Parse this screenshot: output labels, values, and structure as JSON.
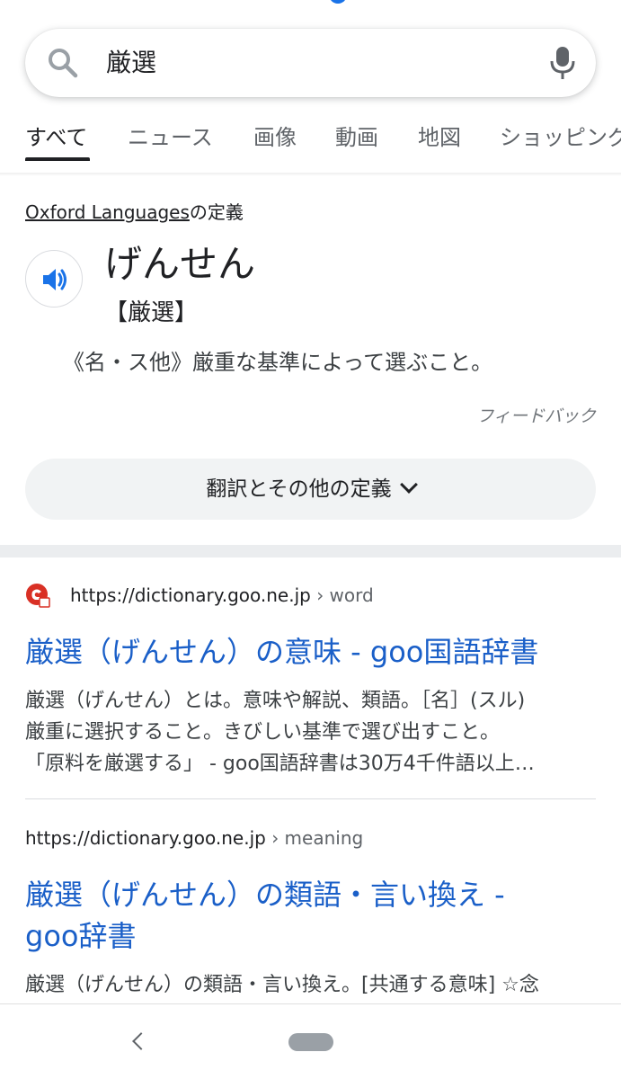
{
  "search": {
    "query": "厳選"
  },
  "tabs": [
    {
      "label": "すべて"
    },
    {
      "label": "ニュース"
    },
    {
      "label": "画像"
    },
    {
      "label": "動画"
    },
    {
      "label": "地図"
    },
    {
      "label": "ショッピング"
    }
  ],
  "dictionary": {
    "source_name": "Oxford Languages",
    "source_suffix": "の定義",
    "reading": "げんせん",
    "kanji": "【厳選】",
    "definition": "《名・ス他》厳重な基準によって選ぶこと。",
    "feedback_label": "フィードバック",
    "more_button_label": "翻訳とその他の定義"
  },
  "results": [
    {
      "url": "https://dictionary.goo.ne.jp",
      "breadcrumb": "› word",
      "title": "厳選（げんせん）の意味 - goo国語辞書",
      "snippet_lines": [
        "厳選（げんせん）とは。意味や解説、類語。［名］(スル)",
        "厳重に選択すること。きびしい基準で選び出すこと。",
        "「原料を厳選する」 - goo国語辞書は30万4千件語以上…"
      ]
    },
    {
      "url": "https://dictionary.goo.ne.jp",
      "breadcrumb": "› meaning",
      "title_lines": [
        "厳選（げんせん）の類語・言い換え -",
        "goo辞書"
      ],
      "snippet": "厳選（げんせん）の類語・言い換え。[共通する意味] ☆念"
    }
  ],
  "colors": {
    "link": "#1a5fc8",
    "speaker": "#1a73e8",
    "favicon": "#d93025"
  },
  "icons": [
    "search-icon",
    "mic-icon",
    "speaker-icon",
    "chevron-down-icon",
    "favicon-icon",
    "back-icon",
    "home-pill"
  ]
}
